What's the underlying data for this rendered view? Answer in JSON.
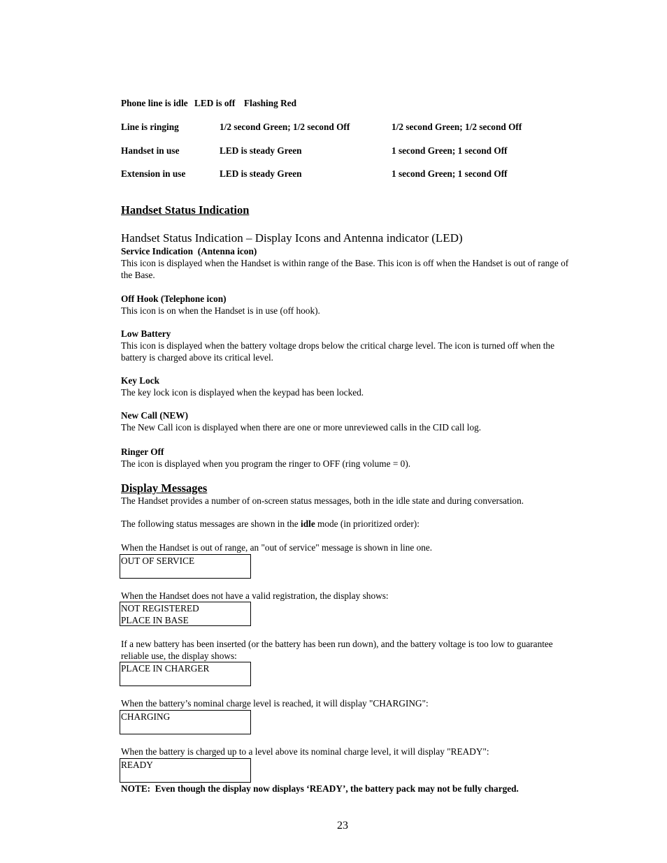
{
  "led_table": {
    "rows": [
      {
        "state": "Phone line is idle",
        "col2": "LED is off",
        "col3": "Flashing Red"
      },
      {
        "state": "Line is ringing",
        "col2": "1/2 second Green; 1/2 second Off",
        "col3": "1/2 second Green; 1/2 second Off"
      },
      {
        "state": "Handset in use",
        "col2": "LED is steady Green",
        "col3": "1 second Green; 1 second Off"
      },
      {
        "state": "Extension in use",
        "col2": "LED is steady Green",
        "col3": "1 second Green; 1 second Off"
      }
    ]
  },
  "handset_status": {
    "heading": "Handset Status Indication",
    "subheading": "Handset Status Indication – Display Icons and Antenna indicator (LED)",
    "items": [
      {
        "title": "Service Indication  (Antenna icon)",
        "text": "This icon is displayed when the Handset is within range of the Base. This icon is off when the Handset is out of range of the Base."
      },
      {
        "title": "Off Hook (Telephone icon)",
        "text": "This icon is on when the Handset is in use (off hook)."
      },
      {
        "title": "Low Battery",
        "text": "This icon is displayed when the battery voltage drops below the critical charge level. The icon is turned off when the battery is charged above its critical level."
      },
      {
        "title": "Key Lock",
        "text": "The key lock icon is displayed when the keypad has been locked."
      },
      {
        "title": "New Call (NEW)",
        "text": "The New Call icon is displayed when there are one or more unreviewed calls in the CID call log."
      },
      {
        "title": "Ringer Off",
        "text": "The icon is displayed when you program the ringer to OFF (ring volume = 0)."
      }
    ]
  },
  "display_messages": {
    "heading": "Display Messages",
    "intro": "The Handset provides a number of on-screen status messages, both in the idle state and during conversation.",
    "idle_intro_before": "The following status messages are shown in the ",
    "idle_intro_bold": "idle",
    "idle_intro_after": " mode (in prioritized order):",
    "messages": [
      {
        "description": "When the Handset is out of range, an \"out of service\" message is shown in line one.",
        "line1": "OUT OF SERVICE",
        "line2": ""
      },
      {
        "description": "When the Handset does not have a valid registration, the display shows:",
        "line1": "NOT REGISTERED",
        "line2": "PLACE IN BASE"
      },
      {
        "description": "If a new battery has been inserted (or the battery has been run down), and the battery voltage is too low to guarantee reliable use, the display shows:",
        "line1": "PLACE IN CHARGER",
        "line2": ""
      },
      {
        "description": "When the battery’s nominal charge level is reached, it will display \"CHARGING\":",
        "line1": "CHARGING",
        "line2": ""
      },
      {
        "description": "When the battery is charged up to a level above its nominal charge level, it will display \"READY\":",
        "line1": "READY",
        "line2": ""
      }
    ],
    "note": "NOTE:  Even though the display now displays ‘READY’, the battery pack may not be fully charged."
  },
  "page_number": "23"
}
